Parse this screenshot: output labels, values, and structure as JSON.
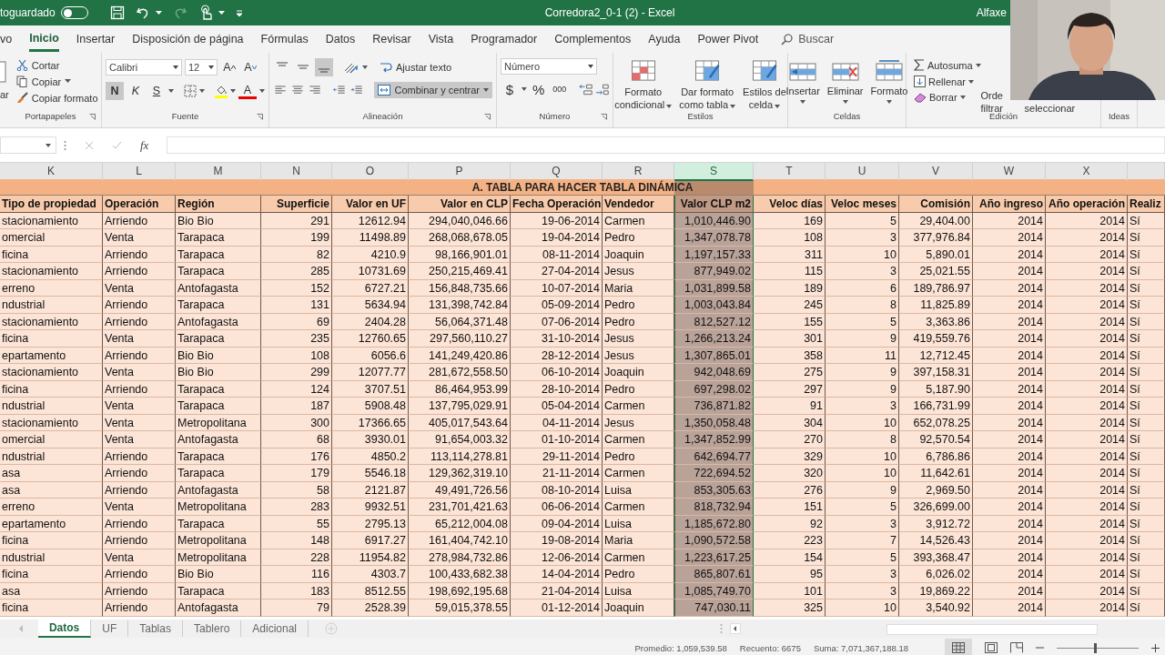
{
  "title_bar": {
    "autosave_label": "toguardado",
    "autosave_on": false,
    "document_title": "Corredora2_0-1 (2)  -  Excel",
    "user": "Alfaxe"
  },
  "ribbon_tabs": [
    {
      "label": "vo",
      "selected": false
    },
    {
      "label": "Inicio",
      "selected": true
    },
    {
      "label": "Insertar",
      "selected": false
    },
    {
      "label": "Disposición de página",
      "selected": false
    },
    {
      "label": "Fórmulas",
      "selected": false
    },
    {
      "label": "Datos",
      "selected": false
    },
    {
      "label": "Revisar",
      "selected": false
    },
    {
      "label": "Vista",
      "selected": false
    },
    {
      "label": "Programador",
      "selected": false
    },
    {
      "label": "Complementos",
      "selected": false
    },
    {
      "label": "Ayuda",
      "selected": false
    },
    {
      "label": "Power Pivot",
      "selected": false
    }
  ],
  "search": {
    "placeholder": "Buscar"
  },
  "clipboard": {
    "paste": "ar",
    "cut": "Cortar",
    "copy": "Copiar",
    "format_painter": "Copiar formato",
    "label": "Portapapeles"
  },
  "font": {
    "family": "Calibri",
    "size": "12",
    "grow": "A",
    "shrink": "A",
    "bold": "N",
    "bold_on": true,
    "italic": "K",
    "underline": "S",
    "font_color": "A",
    "label": "Fuente"
  },
  "alignment": {
    "bottom_align_on": true,
    "wrap_text": "Ajustar texto",
    "merge": "Combinar y centrar",
    "merge_on": true,
    "label": "Alineación"
  },
  "number": {
    "format": "Número",
    "currency": "$",
    "percent": "%",
    "thousands": "000",
    "label": "Número"
  },
  "styles": {
    "buttons": [
      [
        "Formato",
        "condicional"
      ],
      [
        "Dar formato",
        "como tabla"
      ],
      [
        "Estilos de",
        "celda"
      ]
    ],
    "label": "Estilos"
  },
  "cells": {
    "buttons": [
      "Insertar",
      "Eliminar",
      "Formato"
    ],
    "label": "Celdas"
  },
  "editing": {
    "autosum": "Autosuma",
    "fill": "Rellenar",
    "clear": "Borrar",
    "sort_filter": [
      "Orde",
      "filtrar"
    ],
    "find_select": "seleccionar",
    "label": "Edición"
  },
  "ideas": {
    "label": "Ideas"
  },
  "formula_bar": {
    "function_label": "fx"
  },
  "sheet": {
    "title": "A. TABLA PARA HACER TABLA DINÁMICA",
    "columns": [
      {
        "letter": "K",
        "header": "Tipo de propiedad",
        "kind": "text",
        "selected": false
      },
      {
        "letter": "L",
        "header": "Operación",
        "kind": "text",
        "selected": false
      },
      {
        "letter": "M",
        "header": "Región",
        "kind": "text",
        "selected": false
      },
      {
        "letter": "N",
        "header": "Superficie",
        "kind": "number",
        "selected": false
      },
      {
        "letter": "O",
        "header": "Valor en UF",
        "kind": "number",
        "selected": false
      },
      {
        "letter": "P",
        "header": "Valor en CLP",
        "kind": "number",
        "selected": false
      },
      {
        "letter": "Q",
        "header": "Fecha Operación",
        "kind": "number",
        "selected": false
      },
      {
        "letter": "R",
        "header": "Vendedor",
        "kind": "text",
        "selected": false
      },
      {
        "letter": "S",
        "header": "Valor CLP m2",
        "kind": "number",
        "selected": true
      },
      {
        "letter": "T",
        "header": "Veloc días",
        "kind": "number",
        "selected": false
      },
      {
        "letter": "U",
        "header": "Veloc meses",
        "kind": "number",
        "selected": false
      },
      {
        "letter": "V",
        "header": "Comisión",
        "kind": "number",
        "selected": false
      },
      {
        "letter": "W",
        "header": "Año ingreso",
        "kind": "number",
        "selected": false
      },
      {
        "letter": "X",
        "header": "Año operación",
        "kind": "number",
        "selected": false
      },
      {
        "header": "Realiz",
        "kind": "text",
        "selected": false
      }
    ],
    "rows": [
      [
        "stacionamiento",
        "Arriendo",
        "Bio Bio",
        "291",
        "12612.94",
        "294,040,046.66",
        "19-06-2014",
        "Carmen",
        "1,010,446.90",
        "169",
        "5",
        "29,404.00",
        "2014",
        "2014",
        "Sí"
      ],
      [
        "omercial",
        "Venta",
        "Tarapaca",
        "199",
        "11498.89",
        "268,068,678.05",
        "19-04-2014",
        "Pedro",
        "1,347,078.78",
        "108",
        "3",
        "377,976.84",
        "2014",
        "2014",
        "Sí"
      ],
      [
        "ficina",
        "Arriendo",
        "Tarapaca",
        "82",
        "4210.9",
        "98,166,901.01",
        "08-11-2014",
        "Joaquin",
        "1,197,157.33",
        "311",
        "10",
        "5,890.01",
        "2014",
        "2014",
        "Sí"
      ],
      [
        "stacionamiento",
        "Arriendo",
        "Tarapaca",
        "285",
        "10731.69",
        "250,215,469.41",
        "27-04-2014",
        "Jesus",
        "877,949.02",
        "115",
        "3",
        "25,021.55",
        "2014",
        "2014",
        "Sí"
      ],
      [
        "erreno",
        "Venta",
        "Antofagasta",
        "152",
        "6727.21",
        "156,848,735.66",
        "10-07-2014",
        "Maria",
        "1,031,899.58",
        "189",
        "6",
        "189,786.97",
        "2014",
        "2014",
        "Sí"
      ],
      [
        "ndustrial",
        "Arriendo",
        "Tarapaca",
        "131",
        "5634.94",
        "131,398,742.84",
        "05-09-2014",
        "Pedro",
        "1,003,043.84",
        "245",
        "8",
        "11,825.89",
        "2014",
        "2014",
        "Sí"
      ],
      [
        "stacionamiento",
        "Arriendo",
        "Antofagasta",
        "69",
        "2404.28",
        "56,064,371.48",
        "07-06-2014",
        "Pedro",
        "812,527.12",
        "155",
        "5",
        "3,363.86",
        "2014",
        "2014",
        "Sí"
      ],
      [
        "ficina",
        "Venta",
        "Tarapaca",
        "235",
        "12760.65",
        "297,560,110.27",
        "31-10-2014",
        "Jesus",
        "1,266,213.24",
        "301",
        "9",
        "419,559.76",
        "2014",
        "2014",
        "Sí"
      ],
      [
        "epartamento",
        "Arriendo",
        "Bio Bio",
        "108",
        "6056.6",
        "141,249,420.86",
        "28-12-2014",
        "Jesus",
        "1,307,865.01",
        "358",
        "11",
        "12,712.45",
        "2014",
        "2014",
        "Sí"
      ],
      [
        "stacionamiento",
        "Venta",
        "Bio Bio",
        "299",
        "12077.77",
        "281,672,558.50",
        "06-10-2014",
        "Joaquin",
        "942,048.69",
        "275",
        "9",
        "397,158.31",
        "2014",
        "2014",
        "Sí"
      ],
      [
        "ficina",
        "Arriendo",
        "Tarapaca",
        "124",
        "3707.51",
        "86,464,953.99",
        "28-10-2014",
        "Pedro",
        "697,298.02",
        "297",
        "9",
        "5,187.90",
        "2014",
        "2014",
        "Sí"
      ],
      [
        "ndustrial",
        "Venta",
        "Tarapaca",
        "187",
        "5908.48",
        "137,795,029.91",
        "05-04-2014",
        "Carmen",
        "736,871.82",
        "91",
        "3",
        "166,731.99",
        "2014",
        "2014",
        "Sí"
      ],
      [
        "stacionamiento",
        "Venta",
        "Metropolitana",
        "300",
        "17366.65",
        "405,017,543.64",
        "04-11-2014",
        "Jesus",
        "1,350,058.48",
        "304",
        "10",
        "652,078.25",
        "2014",
        "2014",
        "Sí"
      ],
      [
        "omercial",
        "Venta",
        "Antofagasta",
        "68",
        "3930.01",
        "91,654,003.32",
        "01-10-2014",
        "Carmen",
        "1,347,852.99",
        "270",
        "8",
        "92,570.54",
        "2014",
        "2014",
        "Sí"
      ],
      [
        "ndustrial",
        "Arriendo",
        "Tarapaca",
        "176",
        "4850.2",
        "113,114,278.81",
        "29-11-2014",
        "Pedro",
        "642,694.77",
        "329",
        "10",
        "6,786.86",
        "2014",
        "2014",
        "Sí"
      ],
      [
        "asa",
        "Arriendo",
        "Tarapaca",
        "179",
        "5546.18",
        "129,362,319.10",
        "21-11-2014",
        "Carmen",
        "722,694.52",
        "320",
        "10",
        "11,642.61",
        "2014",
        "2014",
        "Sí"
      ],
      [
        "asa",
        "Arriendo",
        "Antofagasta",
        "58",
        "2121.87",
        "49,491,726.56",
        "08-10-2014",
        "Luisa",
        "853,305.63",
        "276",
        "9",
        "2,969.50",
        "2014",
        "2014",
        "Sí"
      ],
      [
        "erreno",
        "Venta",
        "Metropolitana",
        "283",
        "9932.51",
        "231,701,421.63",
        "06-06-2014",
        "Carmen",
        "818,732.94",
        "151",
        "5",
        "326,699.00",
        "2014",
        "2014",
        "Sí"
      ],
      [
        "epartamento",
        "Arriendo",
        "Tarapaca",
        "55",
        "2795.13",
        "65,212,004.08",
        "09-04-2014",
        "Luisa",
        "1,185,672.80",
        "92",
        "3",
        "3,912.72",
        "2014",
        "2014",
        "Sí"
      ],
      [
        "ficina",
        "Arriendo",
        "Metropolitana",
        "148",
        "6917.27",
        "161,404,742.10",
        "19-08-2014",
        "Maria",
        "1,090,572.58",
        "223",
        "7",
        "14,526.43",
        "2014",
        "2014",
        "Sí"
      ],
      [
        "ndustrial",
        "Venta",
        "Metropolitana",
        "228",
        "11954.82",
        "278,984,732.86",
        "12-06-2014",
        "Carmen",
        "1,223,617.25",
        "154",
        "5",
        "393,368.47",
        "2014",
        "2014",
        "Sí"
      ],
      [
        "ficina",
        "Arriendo",
        "Bio Bio",
        "116",
        "4303.7",
        "100,433,682.38",
        "14-04-2014",
        "Pedro",
        "865,807.61",
        "95",
        "3",
        "6,026.02",
        "2014",
        "2014",
        "Sí"
      ],
      [
        "asa",
        "Arriendo",
        "Tarapaca",
        "183",
        "8512.55",
        "198,692,195.68",
        "21-04-2014",
        "Luisa",
        "1,085,749.70",
        "101",
        "3",
        "19,869.22",
        "2014",
        "2014",
        "Sí"
      ],
      [
        "ficina",
        "Arriendo",
        "Antofagasta",
        "79",
        "2528.39",
        "59,015,378.55",
        "01-12-2014",
        "Joaquin",
        "747,030.11",
        "325",
        "10",
        "3,540.92",
        "2014",
        "2014",
        "Sí"
      ]
    ]
  },
  "sheet_tabs": [
    {
      "label": "Datos",
      "selected": true
    },
    {
      "label": "UF",
      "selected": false
    },
    {
      "label": "Tablas",
      "selected": false
    },
    {
      "label": "Tablero",
      "selected": false
    },
    {
      "label": "Adicional",
      "selected": false
    }
  ],
  "status_bar": {
    "average": "Promedio: 1,059,539.58",
    "count": "Recuento: 6675",
    "sum": "Suma: 7,071,367,188.18",
    "zoom": {
      "level": 0.45
    }
  }
}
